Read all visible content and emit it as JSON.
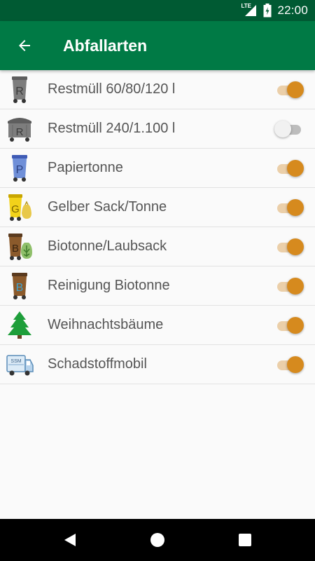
{
  "status_bar": {
    "network": "LTE",
    "time": "22:00"
  },
  "app_bar": {
    "title": "Abfallarten",
    "back_icon": "arrow-back-icon"
  },
  "colors": {
    "primary": "#007A45",
    "primary_dark": "#005A33",
    "accent": "#D68A1E"
  },
  "items": [
    {
      "label": "Restmüll 60/80/120 l",
      "icon_letter": "R",
      "icon": "restmuell-bin-icon",
      "enabled": true
    },
    {
      "label": "Restmüll 240/1.100 l",
      "icon_letter": "R",
      "icon": "restmuell-container-icon",
      "enabled": false
    },
    {
      "label": "Papiertonne",
      "icon_letter": "P",
      "icon": "paper-bin-icon",
      "enabled": true
    },
    {
      "label": "Gelber Sack/Tonne",
      "icon_letter": "G",
      "icon": "yellow-bin-bag-icon",
      "enabled": true
    },
    {
      "label": "Biotonne/Laubsack",
      "icon_letter": "B",
      "icon": "bio-bin-leaf-bag-icon",
      "enabled": true
    },
    {
      "label": "Reinigung Biotonne",
      "icon_letter": "B",
      "icon": "bio-bin-cleaning-icon",
      "enabled": true
    },
    {
      "label": "Weihnachtsbäume",
      "icon": "christmas-tree-icon",
      "enabled": true
    },
    {
      "label": "Schadstoffmobil",
      "icon_letter": "SSM",
      "icon": "hazardous-waste-truck-icon",
      "enabled": true
    }
  ],
  "nav_bar": {
    "back": "nav-back-icon",
    "home": "nav-home-icon",
    "recents": "nav-recents-icon"
  }
}
